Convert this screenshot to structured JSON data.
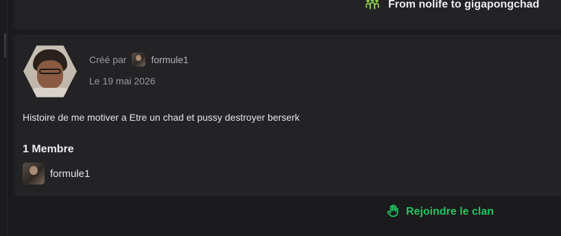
{
  "group": {
    "title": "From nolife to gigapongchad",
    "title_icon": "group-people-icon"
  },
  "clan": {
    "created_by_label": "Créé par",
    "creator": "formule1",
    "date": "Le 19 mai 2026",
    "description": "Histoire de me motiver a Etre un chad et pussy destroyer berserk",
    "members_title": "1 Membre",
    "members": [
      {
        "name": "formule1"
      }
    ]
  },
  "actions": {
    "join_label": "Rejoindre le clan",
    "join_icon": "hand-icon"
  },
  "colors": {
    "accent_green": "#23c35e",
    "icon_green": "#8fd14f",
    "card_bg": "#232326",
    "page_bg": "#1b1b1d"
  }
}
